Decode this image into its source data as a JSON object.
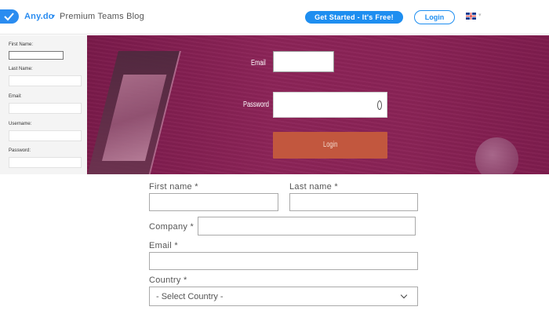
{
  "header": {
    "brand": "Any.do",
    "blog_title": "Premium Teams Blog",
    "get_started_label": "Get Started - It's Free!",
    "login_label": "Login"
  },
  "side_form": {
    "first_name_label": "First Name:",
    "last_name_label": "Last Name:",
    "email_label": "Email:",
    "username_label": "Username:",
    "password_label": "Password:"
  },
  "hero": {
    "email_label": "Email",
    "password_label": "Password",
    "login_label": "Login"
  },
  "form": {
    "first_name_label": "First name *",
    "last_name_label": "Last name *",
    "company_label": "Company *",
    "email_label": "Email *",
    "country_label": "Country *",
    "country_selected": "- Select Country -"
  },
  "colors": {
    "accent": "#1e8ef0",
    "hero_bg": "#8a2356",
    "hero_button": "#c2573e"
  }
}
